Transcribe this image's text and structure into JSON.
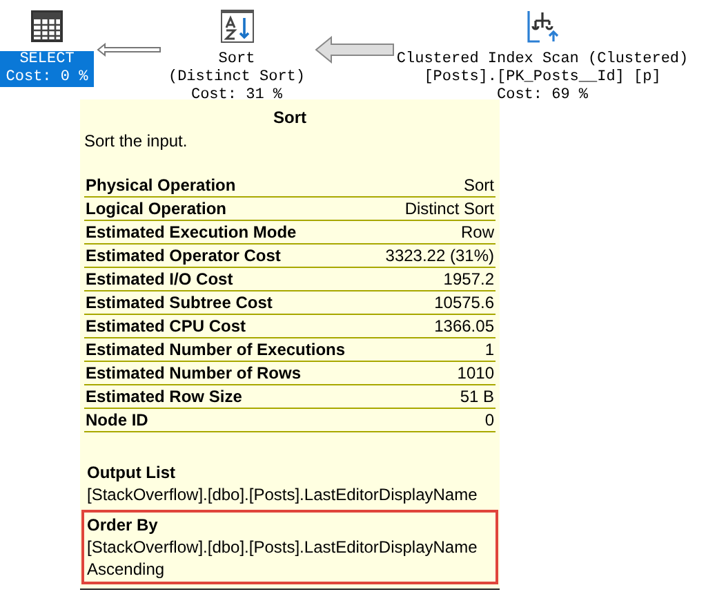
{
  "plan": {
    "nodes": [
      {
        "kind": "select",
        "selected": true,
        "lines": [
          "SELECT",
          "Cost: 0 %"
        ]
      },
      {
        "kind": "sort",
        "selected": false,
        "lines": [
          "Sort",
          "(Distinct Sort)",
          "Cost: 31 %"
        ]
      },
      {
        "kind": "scan",
        "selected": false,
        "lines": [
          "Clustered Index Scan (Clustered)",
          "[Posts].[PK_Posts__Id] [p]",
          "Cost: 69 %"
        ]
      }
    ]
  },
  "tooltip": {
    "title": "Sort",
    "description": "Sort the input.",
    "properties": [
      {
        "label": "Physical Operation",
        "value": "Sort"
      },
      {
        "label": "Logical Operation",
        "value": "Distinct Sort"
      },
      {
        "label": "Estimated Execution Mode",
        "value": "Row"
      },
      {
        "label": "Estimated Operator Cost",
        "value": "3323.22 (31%)"
      },
      {
        "label": "Estimated I/O Cost",
        "value": "1957.2"
      },
      {
        "label": "Estimated Subtree Cost",
        "value": "10575.6"
      },
      {
        "label": "Estimated CPU Cost",
        "value": "1366.05"
      },
      {
        "label": "Estimated Number of Executions",
        "value": "1"
      },
      {
        "label": "Estimated Number of Rows",
        "value": "1010"
      },
      {
        "label": "Estimated Row Size",
        "value": "51 B"
      },
      {
        "label": "Node ID",
        "value": "0"
      }
    ],
    "sections": [
      {
        "heading": "Output List",
        "highlighted": false,
        "values": [
          "[StackOverflow].[dbo].[Posts].LastEditorDisplayName"
        ]
      },
      {
        "heading": "Order By",
        "highlighted": true,
        "values": [
          "[StackOverflow].[dbo].[Posts].LastEditorDisplayName",
          "Ascending"
        ]
      }
    ]
  }
}
